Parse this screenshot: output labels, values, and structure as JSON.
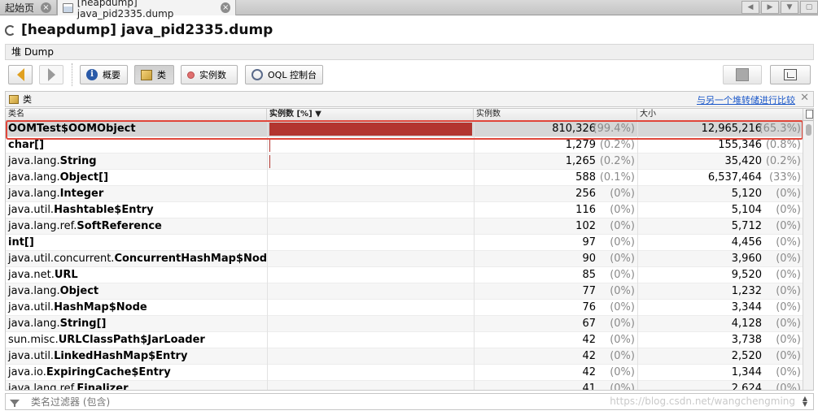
{
  "tabs": {
    "home": "起始页",
    "active": "[heapdump] java_pid2335.dump"
  },
  "title": "[heapdump] java_pid2335.dump",
  "view_label": "堆 Dump",
  "toolbar": {
    "summary": "概要",
    "classes": "类",
    "instances": "实例数",
    "oql": "OQL 控制台"
  },
  "panel": {
    "title": "类",
    "compare_link": "与另一个堆转储进行比较"
  },
  "columns": {
    "name": "类名",
    "instances_pct": "实例数 [%] ▼",
    "instances": "实例数",
    "size": "大小"
  },
  "rows": [
    {
      "pkg": "",
      "cls": "OOMTest$OOMObject",
      "bold_all": true,
      "bar_fraction": 0.994,
      "instances": "810,326",
      "inst_pct": "(99.4%)",
      "size": "12,965,216",
      "size_pct": "(65.3%)"
    },
    {
      "pkg": "",
      "cls": "char[]",
      "bold_all": true,
      "bar_fraction": 0.002,
      "instances": "1,279",
      "inst_pct": "(0.2%)",
      "size": "155,346",
      "size_pct": "(0.8%)"
    },
    {
      "pkg": "java.lang.",
      "cls": "String",
      "bar_fraction": 0.002,
      "instances": "1,265",
      "inst_pct": "(0.2%)",
      "size": "35,420",
      "size_pct": "(0.2%)"
    },
    {
      "pkg": "java.lang.",
      "cls": "Object[]",
      "bar_fraction": 0.001,
      "instances": "588",
      "inst_pct": "(0.1%)",
      "size": "6,537,464",
      "size_pct": "(33%)"
    },
    {
      "pkg": "java.lang.",
      "cls": "Integer",
      "bar_fraction": 0,
      "instances": "256",
      "inst_pct": "(0%)",
      "size": "5,120",
      "size_pct": "(0%)"
    },
    {
      "pkg": "java.util.",
      "cls": "Hashtable$Entry",
      "bar_fraction": 0,
      "instances": "116",
      "inst_pct": "(0%)",
      "size": "5,104",
      "size_pct": "(0%)"
    },
    {
      "pkg": "java.lang.ref.",
      "cls": "SoftReference",
      "bar_fraction": 0,
      "instances": "102",
      "inst_pct": "(0%)",
      "size": "5,712",
      "size_pct": "(0%)"
    },
    {
      "pkg": "",
      "cls": "int[]",
      "bold_all": true,
      "bar_fraction": 0,
      "instances": "97",
      "inst_pct": "(0%)",
      "size": "4,456",
      "size_pct": "(0%)"
    },
    {
      "pkg": "java.util.concurrent.",
      "cls": "ConcurrentHashMap$Node",
      "bar_fraction": 0,
      "instances": "90",
      "inst_pct": "(0%)",
      "size": "3,960",
      "size_pct": "(0%)"
    },
    {
      "pkg": "java.net.",
      "cls": "URL",
      "bar_fraction": 0,
      "instances": "85",
      "inst_pct": "(0%)",
      "size": "9,520",
      "size_pct": "(0%)"
    },
    {
      "pkg": "java.lang.",
      "cls": "Object",
      "bar_fraction": 0,
      "instances": "77",
      "inst_pct": "(0%)",
      "size": "1,232",
      "size_pct": "(0%)"
    },
    {
      "pkg": "java.util.",
      "cls": "HashMap$Node",
      "bar_fraction": 0,
      "instances": "76",
      "inst_pct": "(0%)",
      "size": "3,344",
      "size_pct": "(0%)"
    },
    {
      "pkg": "java.lang.",
      "cls": "String[]",
      "bar_fraction": 0,
      "instances": "67",
      "inst_pct": "(0%)",
      "size": "4,128",
      "size_pct": "(0%)"
    },
    {
      "pkg": "sun.misc.",
      "cls": "URLClassPath$JarLoader",
      "bar_fraction": 0,
      "instances": "42",
      "inst_pct": "(0%)",
      "size": "3,738",
      "size_pct": "(0%)"
    },
    {
      "pkg": "java.util.",
      "cls": "LinkedHashMap$Entry",
      "bar_fraction": 0,
      "instances": "42",
      "inst_pct": "(0%)",
      "size": "2,520",
      "size_pct": "(0%)"
    },
    {
      "pkg": "java.io.",
      "cls": "ExpiringCache$Entry",
      "bar_fraction": 0,
      "instances": "42",
      "inst_pct": "(0%)",
      "size": "1,344",
      "size_pct": "(0%)"
    },
    {
      "pkg": "java.lang.ref.",
      "cls": "Finalizer",
      "bar_fraction": 0,
      "instances": "41",
      "inst_pct": "(0%)",
      "size": "2,624",
      "size_pct": "(0%)"
    }
  ],
  "filter": {
    "placeholder": "类名过滤器 (包含)"
  },
  "watermark": "https://blog.csdn.net/wangchengming",
  "colors": {
    "bar": "#b3352f",
    "highlight": "#e0463a",
    "link": "#1a57c9"
  }
}
